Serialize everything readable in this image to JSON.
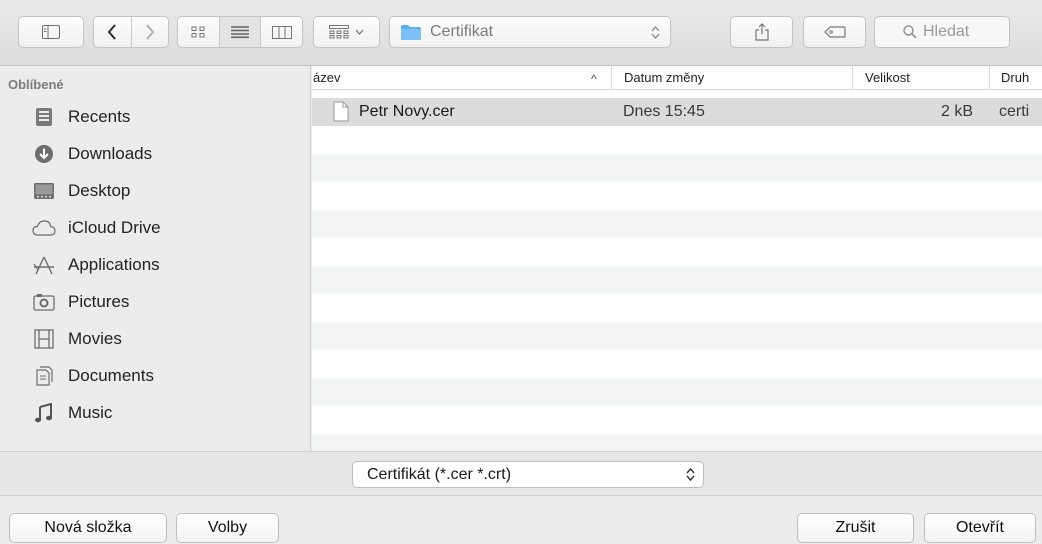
{
  "toolbar": {
    "path": {
      "folder": "Certifikat"
    },
    "search": {
      "placeholder": "Hledat"
    }
  },
  "sidebar": {
    "heading": "Oblíbené",
    "items": [
      {
        "label": "Recents",
        "icon": "recents-icon"
      },
      {
        "label": "Downloads",
        "icon": "downloads-icon"
      },
      {
        "label": "Desktop",
        "icon": "desktop-icon"
      },
      {
        "label": "iCloud Drive",
        "icon": "icloud-icon"
      },
      {
        "label": "Applications",
        "icon": "applications-icon"
      },
      {
        "label": "Pictures",
        "icon": "pictures-icon"
      },
      {
        "label": "Movies",
        "icon": "movies-icon"
      },
      {
        "label": "Documents",
        "icon": "documents-icon"
      },
      {
        "label": "Music",
        "icon": "music-icon"
      }
    ]
  },
  "filelist": {
    "columns": {
      "name": "ázev",
      "date": "Datum změny",
      "size": "Velikost",
      "kind": "Druh"
    },
    "sort_indicator": "^",
    "files": [
      {
        "name": "Petr Novy.cer",
        "date": "Dnes 15:45",
        "size": "2 kB",
        "kind": "certi"
      }
    ]
  },
  "format": {
    "selected": "Certifikát (*.cer *.crt)"
  },
  "buttons": {
    "new_folder": "Nová složka",
    "options": "Volby",
    "cancel": "Zrušit",
    "open": "Otevřít"
  },
  "colors": {
    "folder_blue": "#5aaef0",
    "selected_row": "#dcdcdc",
    "stripe": "#f4f5f5"
  }
}
